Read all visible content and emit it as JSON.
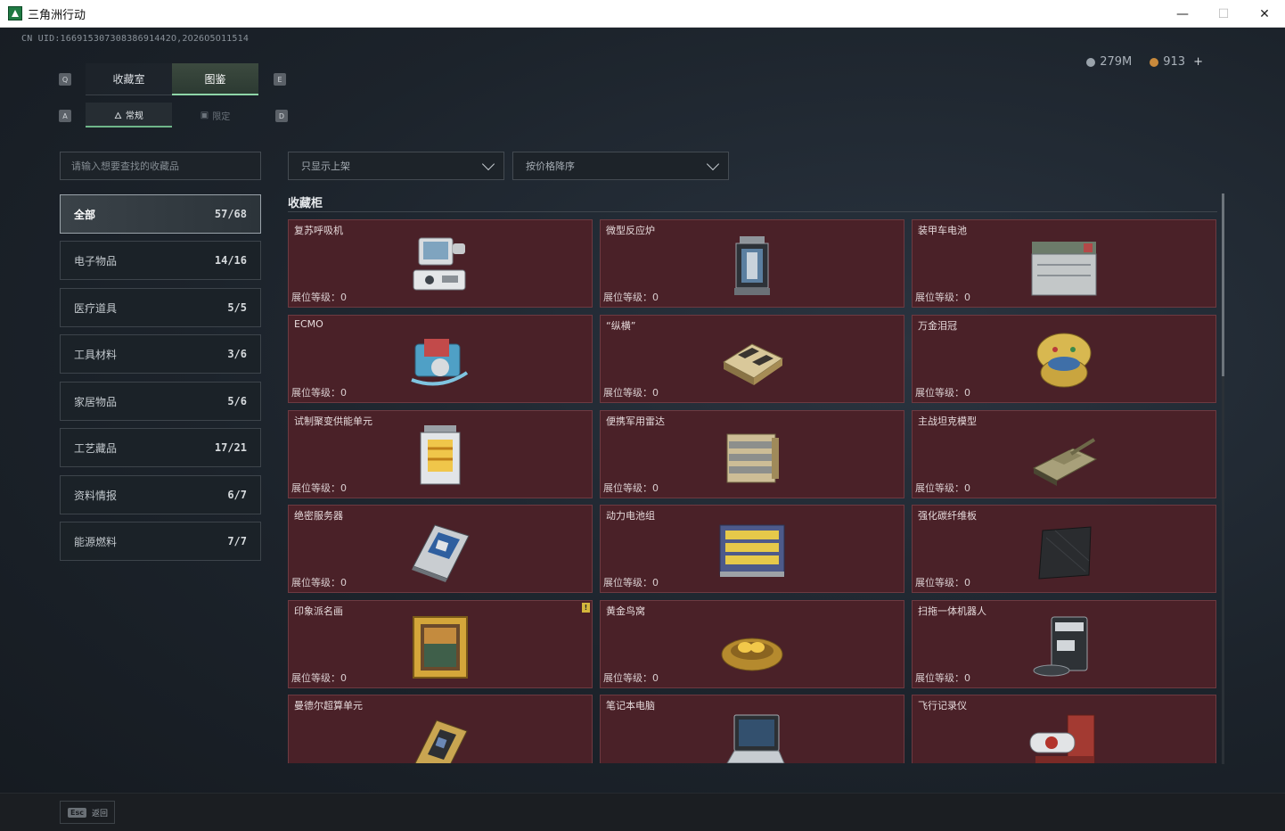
{
  "window": {
    "title": "三角洲行动",
    "controls": [
      "—",
      "☐",
      "✕"
    ]
  },
  "header": {
    "uid": "CN UID:16691530730838691442O,2O26O5O11514",
    "currency": [
      {
        "icon": "silver-coin-icon",
        "value": "279M"
      },
      {
        "icon": "gold-coin-icon",
        "value": "913"
      }
    ],
    "plus": "+"
  },
  "tabs": {
    "key_left": "Q",
    "key_right": "E",
    "items": [
      {
        "label": "收藏室",
        "active": false
      },
      {
        "label": "图鉴",
        "active": true
      }
    ]
  },
  "subtabs": {
    "key_left": "A",
    "key_right": "D",
    "items": [
      {
        "label": "常规",
        "active": true
      },
      {
        "label": "限定",
        "active": false
      }
    ]
  },
  "search": {
    "placeholder": "请输入想要查找的收藏品"
  },
  "filters": {
    "shelf": "只显示上架",
    "sort": "按价格降序"
  },
  "categories": [
    {
      "label": "全部",
      "count": "57/68",
      "active": true
    },
    {
      "label": "电子物品",
      "count": "14/16"
    },
    {
      "label": "医疗道具",
      "count": "5/5"
    },
    {
      "label": "工具材料",
      "count": "3/6"
    },
    {
      "label": "家居物品",
      "count": "5/6"
    },
    {
      "label": "工艺藏品",
      "count": "17/21"
    },
    {
      "label": "资料情报",
      "count": "6/7"
    },
    {
      "label": "能源燃料",
      "count": "7/7"
    }
  ],
  "section": {
    "title": "收藏柜"
  },
  "items": [
    {
      "name": "复苏呼吸机",
      "level": "展位等级：0",
      "icon": "ventilator-icon"
    },
    {
      "name": "微型反应炉",
      "level": "展位等级：0",
      "icon": "reactor-icon"
    },
    {
      "name": "装甲车电池",
      "level": "展位等级：0",
      "icon": "battery-icon"
    },
    {
      "name": "ECMO",
      "level": "展位等级：0",
      "icon": "ecmo-icon"
    },
    {
      "name": "“纵横”",
      "level": "展位等级：0",
      "icon": "chessboard-icon"
    },
    {
      "name": "万金泪冠",
      "level": "展位等级：0",
      "icon": "jeweled-egg-icon"
    },
    {
      "name": "试制聚变供能单元",
      "level": "展位等级：0",
      "icon": "fusion-cell-icon"
    },
    {
      "name": "便携军用雷达",
      "level": "展位等级：0",
      "icon": "radar-icon"
    },
    {
      "name": "主战坦克模型",
      "level": "展位等级：0",
      "icon": "tank-icon"
    },
    {
      "name": "绝密服务器",
      "level": "展位等级：0",
      "icon": "server-icon"
    },
    {
      "name": "动力电池组",
      "level": "展位等级：0",
      "icon": "battery-pack-icon"
    },
    {
      "name": "强化碳纤维板",
      "level": "展位等级：0",
      "icon": "carbon-plate-icon"
    },
    {
      "name": "印象派名画",
      "level": "展位等级：0",
      "icon": "painting-icon",
      "badge": "!"
    },
    {
      "name": "黄金鸟窝",
      "level": "展位等级：0",
      "icon": "golden-nest-icon"
    },
    {
      "name": "扫拖一体机器人",
      "level": "展位等级：0",
      "icon": "robot-vacuum-icon"
    },
    {
      "name": "曼德尔超算单元",
      "level": "",
      "icon": "supercompute-icon"
    },
    {
      "name": "笔记本电脑",
      "level": "",
      "icon": "laptop-icon"
    },
    {
      "name": "飞行记录仪",
      "level": "",
      "icon": "flight-recorder-icon"
    }
  ],
  "footer": {
    "key": "Esc",
    "label": "返回"
  }
}
